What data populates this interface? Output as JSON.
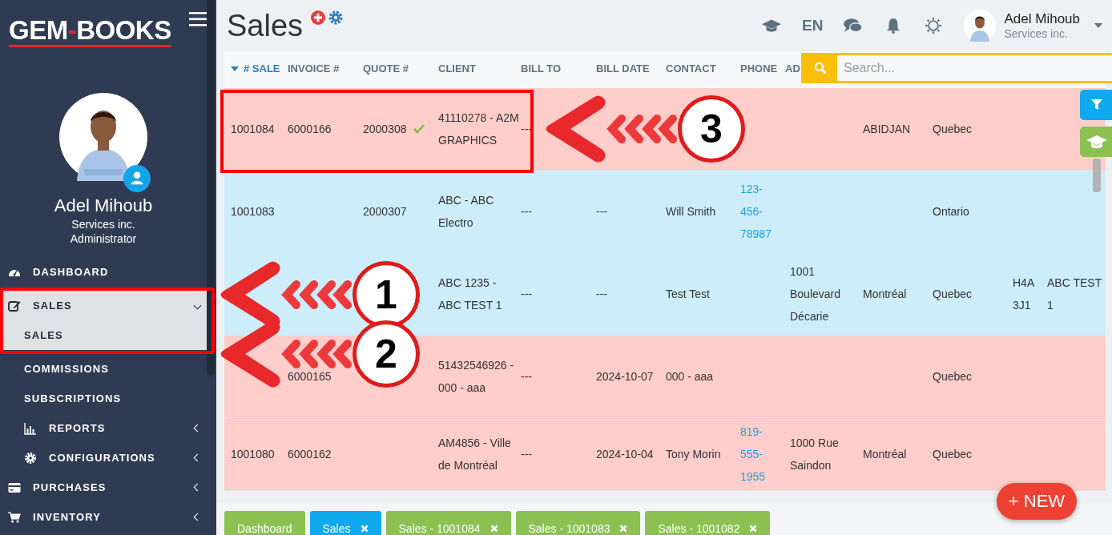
{
  "sidebar": {
    "logo": {
      "left": "GEM",
      "dash": "-",
      "right": "BOOKS"
    },
    "user": {
      "name": "Adel Mihoub",
      "company": "Services inc.",
      "role": "Administrator"
    },
    "items": [
      {
        "label": "DASHBOARD",
        "kind": "link",
        "selected": false
      },
      {
        "label": "SALES",
        "kind": "menu",
        "expanded": true,
        "selected": true,
        "children": [
          {
            "label": "SALES",
            "kind": "link",
            "selected": true
          },
          {
            "label": "COMMISSIONS",
            "kind": "link",
            "selected": false
          },
          {
            "label": "SUBSCRIPTIONS",
            "kind": "link",
            "selected": false
          },
          {
            "label": "REPORTS",
            "kind": "menu",
            "expanded": false,
            "selected": false
          },
          {
            "label": "CONFIGURATIONS",
            "kind": "menu",
            "expanded": false,
            "selected": false
          }
        ]
      },
      {
        "label": "PURCHASES",
        "kind": "menu",
        "expanded": false,
        "selected": false
      },
      {
        "label": "INVENTORY",
        "kind": "menu",
        "expanded": false,
        "selected": false
      }
    ]
  },
  "page": {
    "title": "Sales"
  },
  "topbar": {
    "language": "EN",
    "user": {
      "name": "Adel Mihoub",
      "company": "Services inc."
    }
  },
  "search": {
    "placeholder": "Search..."
  },
  "table": {
    "columns": [
      {
        "label": "# SALE",
        "sorted": true
      },
      {
        "label": "INVOICE #",
        "sorted": false
      },
      {
        "label": "QUOTE #",
        "sorted": false
      },
      {
        "label": "CLIENT",
        "sorted": false
      },
      {
        "label": "BILL TO",
        "sorted": false
      },
      {
        "label": "BILL DATE",
        "sorted": false
      },
      {
        "label": "CONTACT",
        "sorted": false
      },
      {
        "label": "PHONE",
        "sorted": false
      },
      {
        "label": "AD",
        "sorted": false
      }
    ],
    "rows": [
      {
        "color": "#ffcdca",
        "approved": true,
        "cells": {
          "sale": "1001084",
          "invoice": "6000166",
          "quote": "2000308",
          "client": "41110278 - A2M GRAPHICS",
          "bill_to": "---",
          "column_10": "ABIDJAN",
          "column_11": "Quebec"
        }
      },
      {
        "color": "#cdedfb",
        "approved": false,
        "cells": {
          "sale": "1001083",
          "quote": "2000307",
          "client": "ABC - ABC Electro",
          "bill_to": "---",
          "bill_date": "---",
          "contact": "Will Smith",
          "phone": "123-456-78987",
          "column_11": "Ontario"
        }
      },
      {
        "color": "#cdedfb",
        "approved": false,
        "cells": {
          "client": "ABC 1235 - ABC TEST 1",
          "bill_to": "---",
          "bill_date": "---",
          "contact": "Test Test",
          "column_9": "1001 Boulevard Décarie",
          "column_10": "Montréal",
          "column_11": "Quebec",
          "column_12": "H4A 3J1",
          "column_13": "ABC TEST 1"
        }
      },
      {
        "color": "#ffcdca",
        "approved": false,
        "cells": {
          "invoice": "6000165",
          "client": "51432546926 - 000 - aaa",
          "bill_to": "---",
          "bill_date": "2024-10-07",
          "contact": "000 - aaa",
          "column_11": "Quebec"
        }
      },
      {
        "color": "#ffcdca",
        "approved": false,
        "cells": {
          "sale": "1001080",
          "invoice": "6000162",
          "client": "AM4856 - Ville de Montréal",
          "bill_to": "---",
          "bill_date": "2024-10-04",
          "contact": "Tony Morin",
          "phone": "819-555-1955",
          "column_9": "1000 Rue Saindon",
          "column_10": "Montréal",
          "column_11": "Quebec"
        }
      }
    ]
  },
  "new_button": {
    "plus": "+",
    "label": "NEW"
  },
  "bottom_tabs": [
    {
      "label": "Dashboard",
      "closable": false,
      "selected": false
    },
    {
      "label": "Sales",
      "closable": true,
      "selected": true
    },
    {
      "label": "Sales - 1001084",
      "closable": true,
      "selected": false
    },
    {
      "label": "Sales - 1001083",
      "closable": true,
      "selected": false
    },
    {
      "label": "Sales - 1001082",
      "closable": true,
      "selected": false
    }
  ],
  "annotations": [
    {
      "number": "3"
    },
    {
      "number": "1"
    },
    {
      "number": "2"
    }
  ]
}
